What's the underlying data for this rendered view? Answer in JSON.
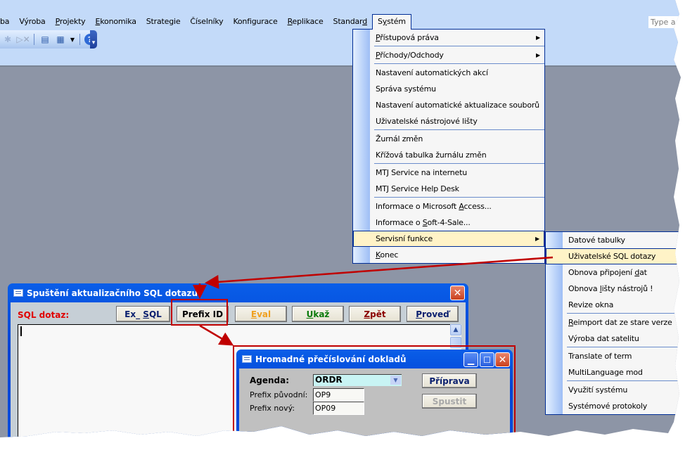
{
  "menubar": {
    "items": [
      {
        "label": "ba",
        "mnemonic": ""
      },
      {
        "label": "Výroba",
        "mnemonic": ""
      },
      {
        "label": "Projekty",
        "mnemonic": "P"
      },
      {
        "label": "Ekonomika",
        "mnemonic": "E"
      },
      {
        "label": "Strategie",
        "mnemonic": "g"
      },
      {
        "label": "Číselníky",
        "mnemonic": "l"
      },
      {
        "label": "Konfigurace",
        "mnemonic": "g"
      },
      {
        "label": "Replikace",
        "mnemonic": "R"
      },
      {
        "label": "Standard",
        "mnemonic": "d"
      },
      {
        "label": "Systém",
        "mnemonic": "y",
        "active": true
      }
    ],
    "help_placeholder": "Type a q"
  },
  "toolbar": {
    "icons": [
      "pin-icon",
      "delete-icon",
      "form-icon",
      "new-object-icon",
      "dropdown-icon",
      "help-icon",
      "toolbar-options-icon"
    ]
  },
  "system_menu": {
    "groups": [
      [
        {
          "label": "Přístupová práva",
          "submenu": true
        },
        {
          "label": "Příchody/Odchody",
          "submenu": true
        }
      ],
      [
        {
          "label": "Nastavení automatických akcí"
        },
        {
          "label": "Správa systému"
        },
        {
          "label": "Nastavení automatické aktualizace souborů"
        },
        {
          "label": "Uživatelské nástrojové lišty"
        }
      ],
      [
        {
          "label": "Žurnál změn"
        },
        {
          "label": "Křížová tabulka žurnálu změn"
        }
      ],
      [
        {
          "label": "MTJ Service na internetu"
        },
        {
          "label": "MTJ Service Help Desk"
        }
      ],
      [
        {
          "label": "Informace o Microsoft Access..."
        },
        {
          "label": "Informace o Soft-4-Sale..."
        }
      ],
      [
        {
          "label": "Servisní funkce",
          "submenu": true,
          "highlighted": true
        }
      ],
      [
        {
          "label": "Konec"
        }
      ]
    ]
  },
  "service_submenu": {
    "groups": [
      [
        {
          "label": "Datové tabulky"
        },
        {
          "label": "Uživatelské SQL dotazy",
          "highlighted": true
        },
        {
          "label": "Obnova připojení dat"
        },
        {
          "label": "Obnova lišty nástrojů !"
        },
        {
          "label": "Revize okna"
        }
      ],
      [
        {
          "label": "Reimport dat ze stare verze"
        },
        {
          "label": "Výroba dat satelitu"
        }
      ],
      [
        {
          "label": "Translate of term"
        },
        {
          "label": "MultiLanguage mod"
        }
      ],
      [
        {
          "label": "Využití systému"
        },
        {
          "label": "Systémové protokoly"
        }
      ]
    ]
  },
  "sql_window": {
    "title": "Spuštění aktualizačního SQL dotazu",
    "label": "SQL dotaz:",
    "label_color": "#e00000",
    "query_value": "",
    "buttons": [
      {
        "label": "Ex_ SQL",
        "color": "#0a1f6e"
      },
      {
        "label": "Prefix ID",
        "color": "#000000"
      },
      {
        "label": "Eval",
        "color": "#f0a020"
      },
      {
        "label": "Ukaž",
        "color": "#0a7a0a"
      },
      {
        "label": "Zpět",
        "color": "#8a0000"
      },
      {
        "label": "Proveď",
        "color": "#0a1f6e"
      }
    ]
  },
  "renumber_window": {
    "title": "Hromadné přečíslování dokladů",
    "agenda_label": "Agenda:",
    "agenda_value": "ORDR",
    "prefix_old_label": "Prefix původní:",
    "prefix_old_value": "OP9",
    "prefix_new_label": "Prefix nový:",
    "prefix_new_value": "OP09",
    "prepare_button": "Příprava",
    "run_button": "Spustit"
  },
  "colors": {
    "annotation_red": "#c00000",
    "menu_highlight": "#fff3c7",
    "menu_border": "#002d96"
  }
}
